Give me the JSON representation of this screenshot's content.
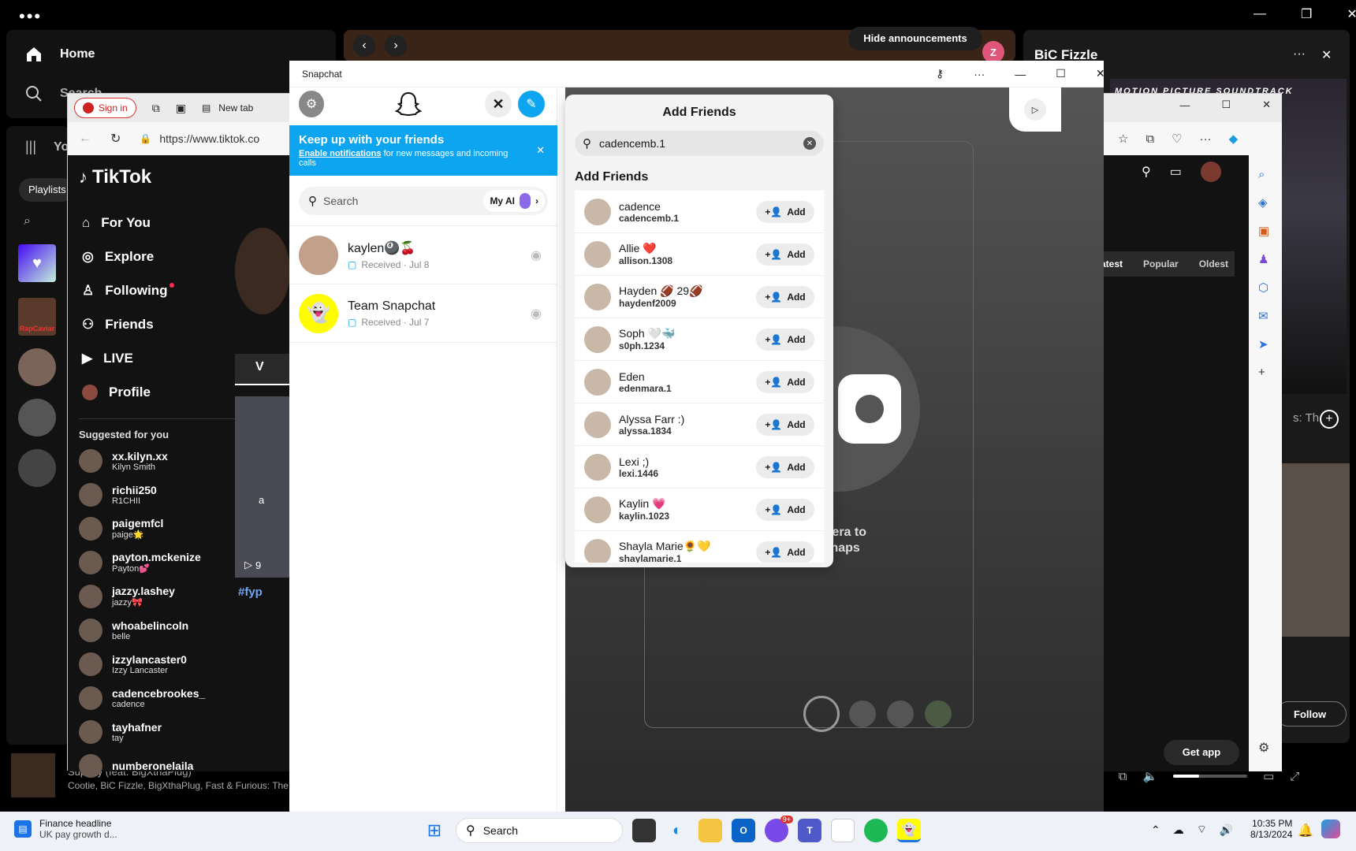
{
  "spotify": {
    "home": "Home",
    "search": "Search",
    "library_short": "Yo",
    "playlists_chip": "Playlists",
    "right_title": "BiC Fizzle",
    "hide_announcements": "Hide announcements",
    "profile_initial": "Z",
    "banner_text": "MOTION PICTURE SOUNDTRACK",
    "now_playing_title": "Supany (feat. BigXthaPlug)",
    "now_playing_artists": "Cootie, BiC Fizzle, BigXthaPlug, Fast & Furious: The Fa",
    "filters": [
      "atest",
      "Popular",
      "Oldest"
    ],
    "follow": "Follow",
    "get_app": "Get app",
    "side_text": "s: Th",
    "rapcaviar": "RapCaviar"
  },
  "edge": {
    "sign_in": "Sign in",
    "new_tab": "New tab",
    "url": "https://www.tiktok.co"
  },
  "tiktok": {
    "logo": "TikTok",
    "nav": [
      "For You",
      "Explore",
      "Following",
      "Friends",
      "LIVE",
      "Profile"
    ],
    "suggested_title": "Suggested for you",
    "suggested": [
      {
        "name": "xx.kilyn.xx",
        "sub": "Kilyn Smith"
      },
      {
        "name": "richii250",
        "sub": "R1CHII"
      },
      {
        "name": "paigemfcl",
        "sub": "paige🌟"
      },
      {
        "name": "payton.mckenize",
        "sub": "Payton💕"
      },
      {
        "name": "jazzy.lashey",
        "sub": "jazzy🎀"
      },
      {
        "name": "whoabelincoln",
        "sub": "belle"
      },
      {
        "name": "izzylancaster0",
        "sub": "Izzy Lancaster"
      },
      {
        "name": "cadencebrookes_",
        "sub": "cadence"
      },
      {
        "name": "tayhafner",
        "sub": "tay"
      },
      {
        "name": "numberonelaila",
        "sub": ""
      }
    ],
    "tab_v": "V",
    "video_label": "a",
    "play_count": "9",
    "hashtag": "#fyp"
  },
  "snapchat": {
    "window_title": "Snapchat",
    "banner_title": "Keep up with your friends",
    "banner_link": "Enable notifications",
    "banner_rest": " for new messages and incoming calls",
    "search_placeholder": "Search",
    "my_ai": "My AI",
    "chats": [
      {
        "name": "kaylen🎱🍒",
        "status": "Received · Jul 8"
      },
      {
        "name": "Team Snapchat",
        "status": "Received · Jul 7"
      }
    ],
    "add_friends_header": "Add Friends",
    "search_value": "cadencemb.1",
    "section_title": "Add Friends",
    "add_label": "Add",
    "friends": [
      {
        "name": "cadence",
        "user": "cadencemb.1"
      },
      {
        "name": "Allie ❤️",
        "user": "allison.1308"
      },
      {
        "name": "Hayden 🏈 29🏈",
        "user": "haydenf2009"
      },
      {
        "name": "Soph 🤍🐳",
        "user": "s0ph.1234"
      },
      {
        "name": "Eden",
        "user": "edenmara.1"
      },
      {
        "name": "Alyssa Farr :)",
        "user": "alyssa.1834"
      },
      {
        "name": "Lexi ;)",
        "user": "lexi.1446"
      },
      {
        "name": "Kaylin 💗",
        "user": "kaylin.1023"
      },
      {
        "name": "Shayla Marie🌻💛",
        "user": "shaylamarie.1"
      }
    ],
    "camera_line1": "amera to",
    "camera_line2": "send Snaps"
  },
  "taskbar": {
    "news_title": "Finance headline",
    "news_sub": "UK pay growth d...",
    "search": "Search",
    "time": "10:35 PM",
    "date": "8/13/2024",
    "chat_badge": "9+"
  }
}
